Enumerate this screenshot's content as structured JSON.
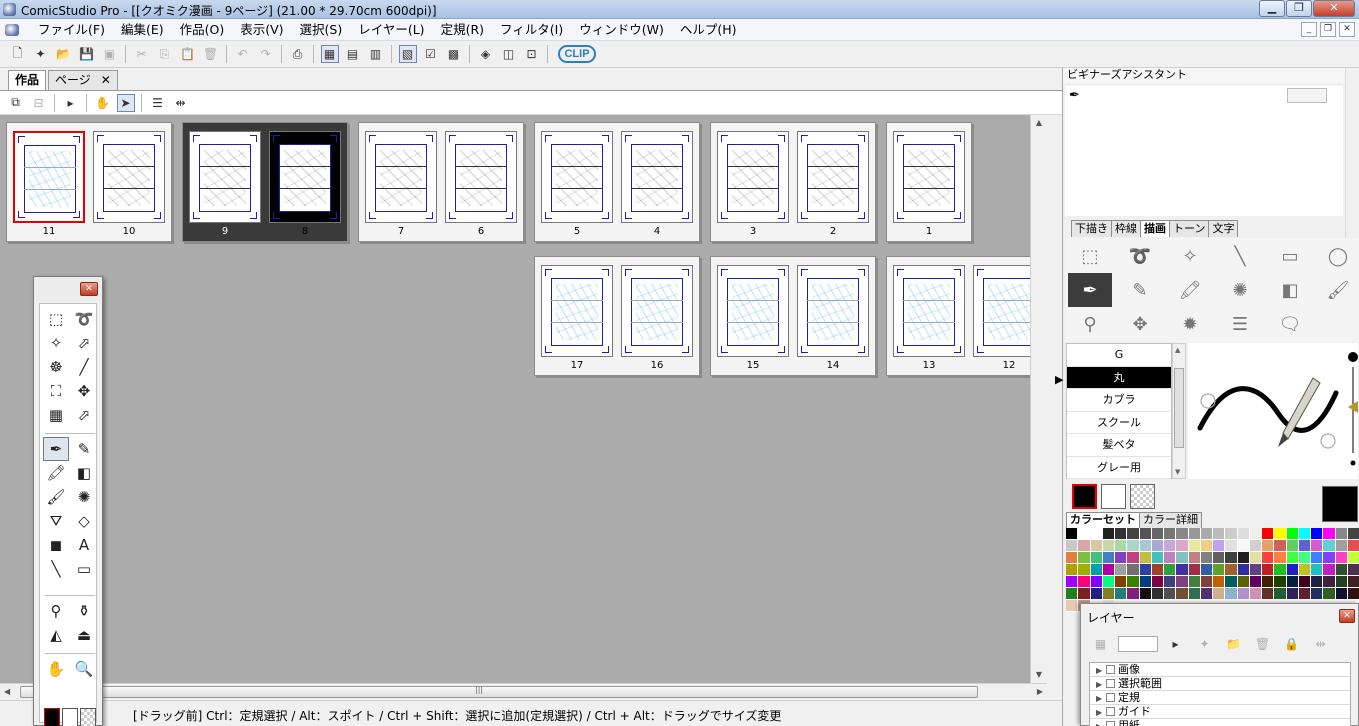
{
  "window": {
    "title": "ComicStudio Pro - [[クオミク漫画 - 9ページ] (21.00 * 29.70cm 600dpi)]"
  },
  "menu": [
    "ファイル(F)",
    "編集(E)",
    "作品(O)",
    "表示(V)",
    "選択(S)",
    "レイヤー(L)",
    "定規(R)",
    "フィルタ(I)",
    "ウィンドウ(W)",
    "ヘルプ(H)"
  ],
  "toolbar": {
    "logo": "CLIP"
  },
  "tabs": {
    "work": "作品",
    "page": "ページ",
    "close": "✕"
  },
  "pages": {
    "row1": [
      "11",
      "10",
      "9",
      "8",
      "7",
      "6",
      "5",
      "4",
      "3",
      "2",
      "1"
    ],
    "row2": [
      "17",
      "16",
      "15",
      "14",
      "13",
      "12"
    ],
    "selected_page": "9",
    "marked_page": "11"
  },
  "status": {
    "text": "[ドラッグ前] Ctrl：定規選択 / Alt：スポイト / Ctrl + Shift：選択に追加(定規選択) / Ctrl + Alt：ドラッグでサイズ変更"
  },
  "dock": {
    "assistant_title": "ビギナーズアシスタント",
    "subtabs": [
      "下描き",
      "枠線",
      "描画",
      "トーン",
      "文字"
    ],
    "active_subtab": "描画",
    "brushes": [
      "G",
      "丸",
      "カブラ",
      "スクール",
      "髪ベタ",
      "グレー用"
    ],
    "selected_brush": "丸",
    "color_tabs": [
      "カラーセット",
      "カラー詳細"
    ],
    "main_color": "#000000"
  },
  "layers": {
    "title": "レイヤー",
    "items": [
      "画像",
      "選択範囲",
      "定規",
      "ガイド",
      "用紙"
    ]
  },
  "colors": {
    "accent_red": "#e60000",
    "frame_blue": "#1c1cb8",
    "canvas_bg": "#ababab"
  }
}
